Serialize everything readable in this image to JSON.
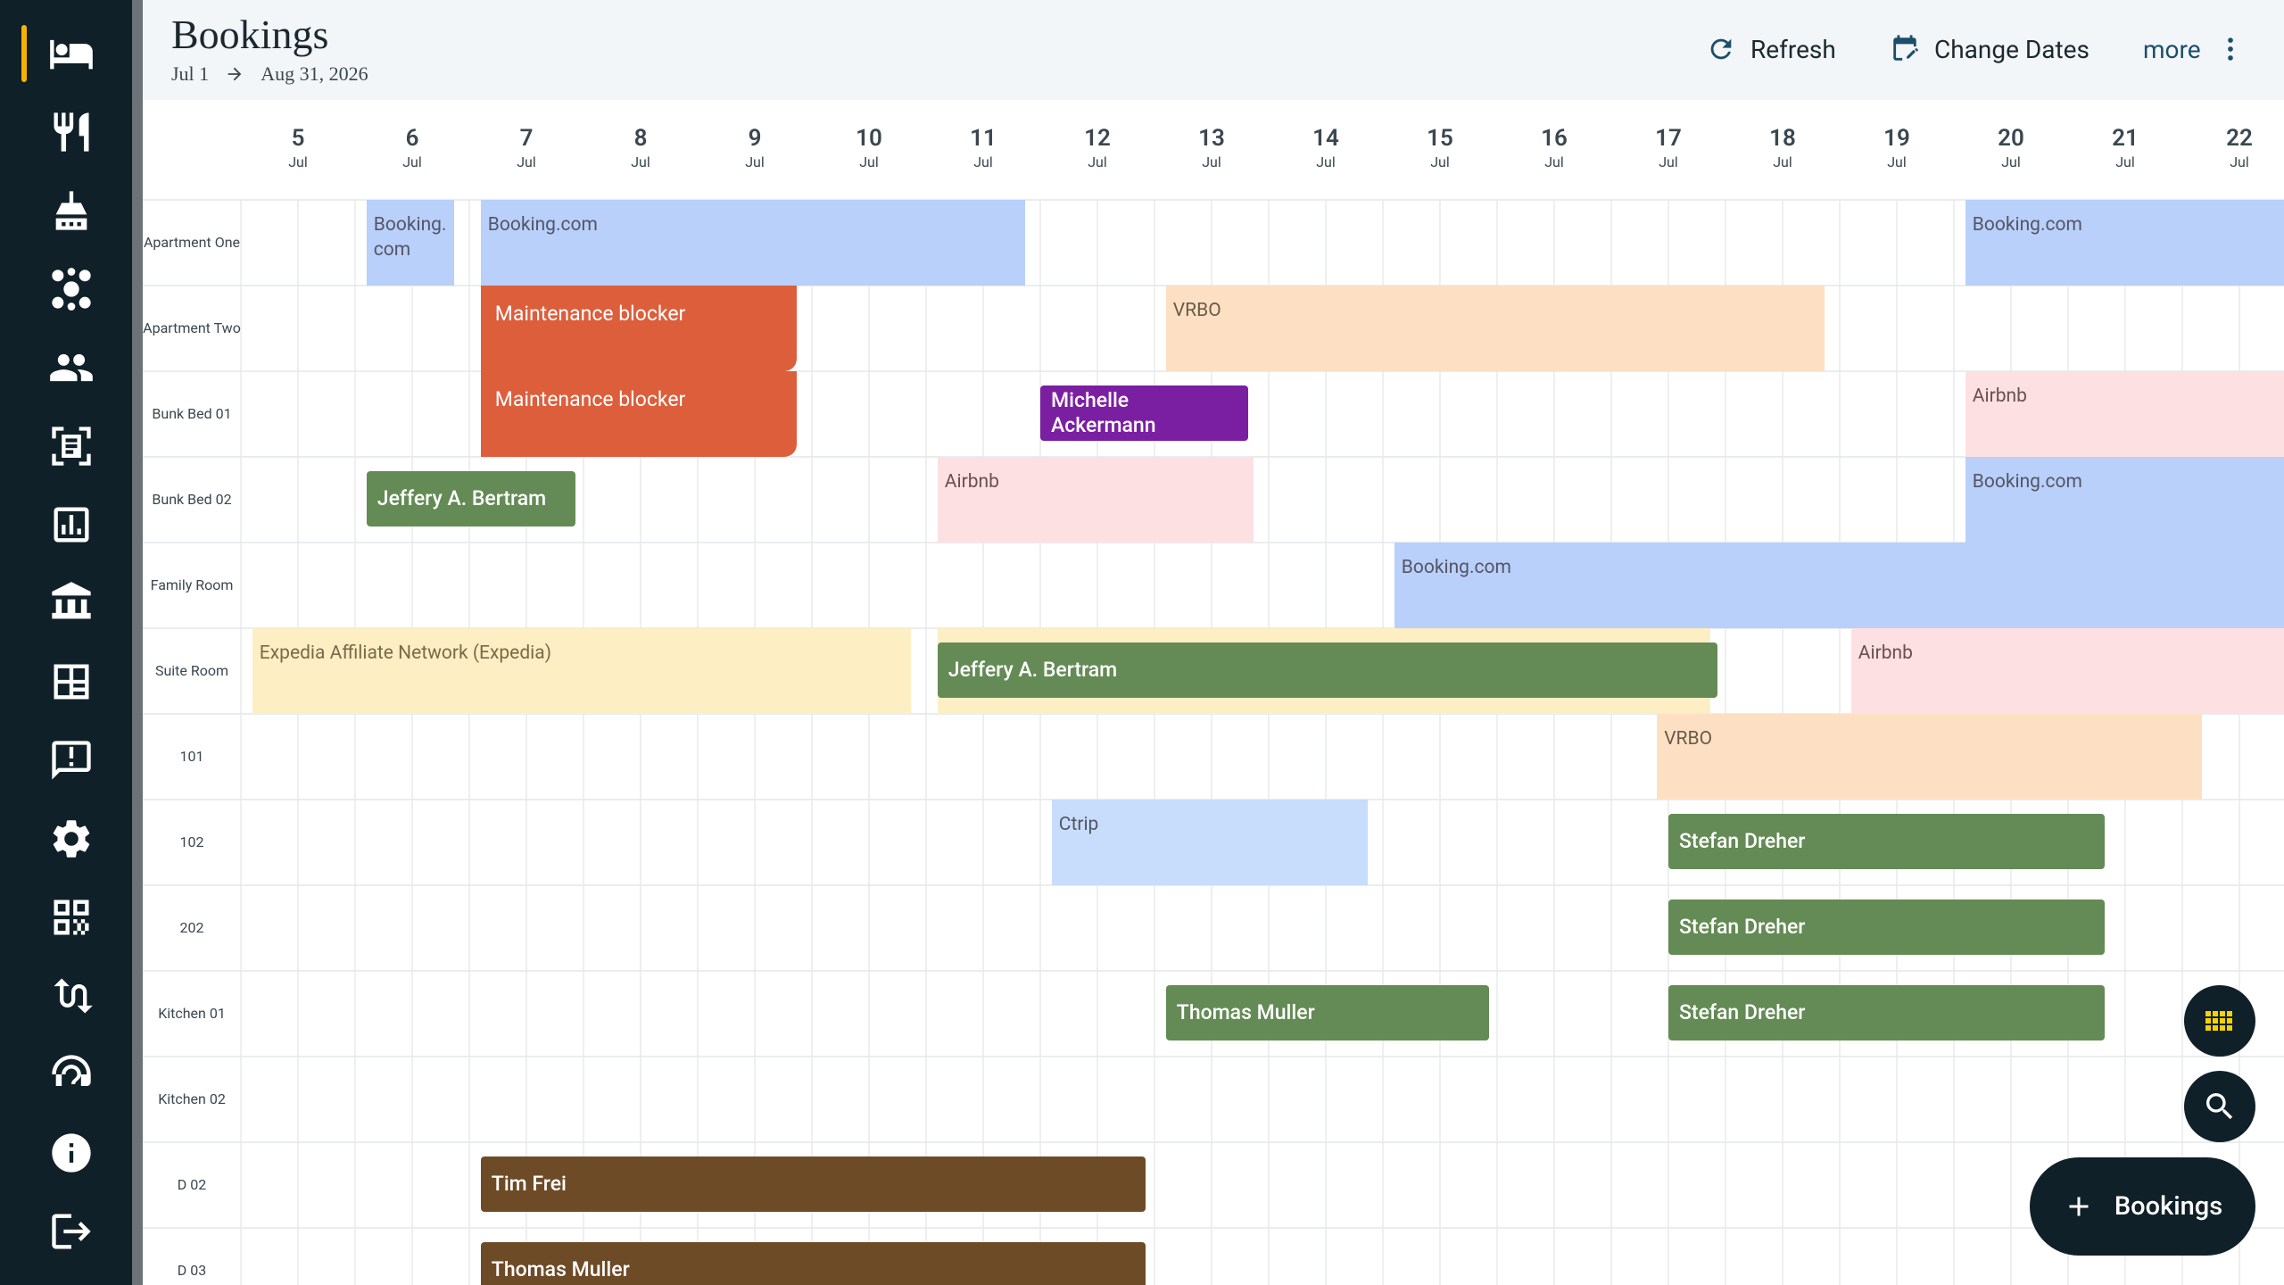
{
  "header": {
    "title": "Bookings",
    "date_from": "Jul 1",
    "date_to": "Aug 31, 2026",
    "refresh_label": "Refresh",
    "change_dates_label": "Change Dates",
    "more_label": "more"
  },
  "sidebar": {
    "items": [
      {
        "icon": "bed-icon",
        "active": true
      },
      {
        "icon": "restaurant-icon"
      },
      {
        "icon": "housekeeping-icon"
      },
      {
        "icon": "hub-icon"
      },
      {
        "icon": "people-icon"
      },
      {
        "icon": "document-scan-icon"
      },
      {
        "icon": "analytics-icon"
      },
      {
        "icon": "bank-icon"
      },
      {
        "icon": "floor-plan-icon"
      },
      {
        "icon": "feedback-icon"
      },
      {
        "icon": "settings-icon"
      },
      {
        "icon": "qr-code-icon"
      },
      {
        "icon": "workflow-icon"
      },
      {
        "icon": "support-agent-icon"
      },
      {
        "icon": "info-icon"
      },
      {
        "icon": "logout-icon"
      }
    ]
  },
  "days": [
    {
      "num": "5",
      "mon": "Jul"
    },
    {
      "num": "6",
      "mon": "Jul"
    },
    {
      "num": "7",
      "mon": "Jul"
    },
    {
      "num": "8",
      "mon": "Jul"
    },
    {
      "num": "9",
      "mon": "Jul"
    },
    {
      "num": "10",
      "mon": "Jul"
    },
    {
      "num": "11",
      "mon": "Jul"
    },
    {
      "num": "12",
      "mon": "Jul"
    },
    {
      "num": "13",
      "mon": "Jul"
    },
    {
      "num": "14",
      "mon": "Jul"
    },
    {
      "num": "15",
      "mon": "Jul"
    },
    {
      "num": "16",
      "mon": "Jul"
    },
    {
      "num": "17",
      "mon": "Jul"
    },
    {
      "num": "18",
      "mon": "Jul"
    },
    {
      "num": "19",
      "mon": "Jul"
    },
    {
      "num": "20",
      "mon": "Jul"
    },
    {
      "num": "21",
      "mon": "Jul"
    },
    {
      "num": "22",
      "mon": "Jul"
    }
  ],
  "rooms": [
    "Apartment One",
    "Apartment Two",
    "Bunk Bed 01",
    "Bunk Bed 02",
    "Family Room",
    "Suite Room",
    "101",
    "102",
    "202",
    "Kitchen 01",
    "Kitchen 02",
    "D 02",
    "D 03"
  ],
  "bookings": [
    {
      "label": "Booking.\ncom",
      "type": "channel",
      "color": "#b8d0fa",
      "text_color": "#556",
      "room": 0,
      "start": 6.1,
      "end": 6.87
    },
    {
      "label": "Booking.com",
      "type": "channel",
      "color": "#b8d0fa",
      "text_color": "#556",
      "room": 0,
      "start": 7.1,
      "end": 11.87
    },
    {
      "label": "Booking.com",
      "type": "channel",
      "color": "#b8d0fa",
      "text_color": "#556",
      "room": 0,
      "start": 20.1,
      "end": 23
    },
    {
      "label": "Maintenance blocker",
      "type": "blocker",
      "color": "#dd5e3b",
      "room": 1,
      "start": 7.1,
      "end": 9.87
    },
    {
      "label": "VRBO",
      "type": "channel",
      "color": "#fde0c4",
      "text_color": "#6b5a48",
      "room": 1,
      "start": 13.1,
      "end": 18.87
    },
    {
      "label": "Maintenance blocker",
      "type": "blocker",
      "color": "#dd5e3b",
      "room": 2,
      "start": 7.1,
      "end": 9.87
    },
    {
      "label": "Michelle Ackermann",
      "type": "guest",
      "color": "#7b1fa2",
      "room": 2,
      "start": 12.0,
      "end": 13.82
    },
    {
      "label": "Airbnb",
      "type": "channel",
      "color": "#fde0e2",
      "text_color": "#6b5050",
      "room": 2,
      "start": 20.1,
      "end": 23
    },
    {
      "label": "Jeffery A. Bertram",
      "type": "guest",
      "color": "#648b55",
      "room": 3,
      "start": 6.1,
      "end": 7.93
    },
    {
      "label": "Airbnb",
      "type": "channel",
      "color": "#fde0e2",
      "text_color": "#6b5050",
      "room": 3,
      "start": 11.1,
      "end": 13.87
    },
    {
      "label": "Booking.com",
      "type": "channel",
      "color": "#b8d0fa",
      "text_color": "#556",
      "room": 3,
      "start": 20.1,
      "end": 23
    },
    {
      "label": "Booking.com",
      "type": "channel",
      "color": "#b8d0fa",
      "text_color": "#556",
      "room": 4,
      "start": 15.1,
      "end": 23
    },
    {
      "label": "Expedia Affiliate Network (Expedia)",
      "type": "channel",
      "color": "#fdeec4",
      "text_color": "#7a6a48",
      "room": 5,
      "start": 5.1,
      "end": 10.87
    },
    {
      "label": "",
      "type": "channel",
      "color": "#fdeec4",
      "text_color": "#7a6a48",
      "room": 5,
      "start": 11.1,
      "end": 17.87
    },
    {
      "label": "Jeffery A. Bertram",
      "type": "guest",
      "color": "#648b55",
      "room": 5,
      "start": 11.1,
      "end": 17.93
    },
    {
      "label": "Airbnb",
      "type": "channel",
      "color": "#fde0e2",
      "text_color": "#6b5050",
      "room": 5,
      "start": 19.1,
      "end": 23
    },
    {
      "label": "VRBO",
      "type": "channel",
      "color": "#fde0c4",
      "text_color": "#6b5a48",
      "room": 6,
      "start": 17.4,
      "end": 22.17
    },
    {
      "label": "Ctrip",
      "type": "channel",
      "color": "#c7ddfb",
      "text_color": "#556",
      "room": 7,
      "start": 12.1,
      "end": 14.87
    },
    {
      "label": "Stefan Dreher",
      "type": "guest",
      "color": "#648b55",
      "room": 7,
      "start": 17.5,
      "end": 21.32
    },
    {
      "label": "Stefan Dreher",
      "type": "guest",
      "color": "#648b55",
      "room": 8,
      "start": 17.5,
      "end": 21.32
    },
    {
      "label": "Thomas Muller",
      "type": "guest",
      "color": "#648b55",
      "room": 9,
      "start": 13.1,
      "end": 15.93
    },
    {
      "label": "Stefan Dreher",
      "type": "guest",
      "color": "#648b55",
      "room": 9,
      "start": 17.5,
      "end": 21.32
    },
    {
      "label": "Tim Frei",
      "type": "guest",
      "color": "#6e4b27",
      "room": 11,
      "start": 7.1,
      "end": 12.92
    },
    {
      "label": "Thomas Muller",
      "type": "guest",
      "color": "#6e4b27",
      "room": 12,
      "start": 7.1,
      "end": 12.92
    }
  ],
  "fab": {
    "bookings_label": "Bookings"
  },
  "colors": {
    "sidebar": "#0f2028",
    "accent": "#f6b300",
    "link": "#1c4f6b"
  }
}
